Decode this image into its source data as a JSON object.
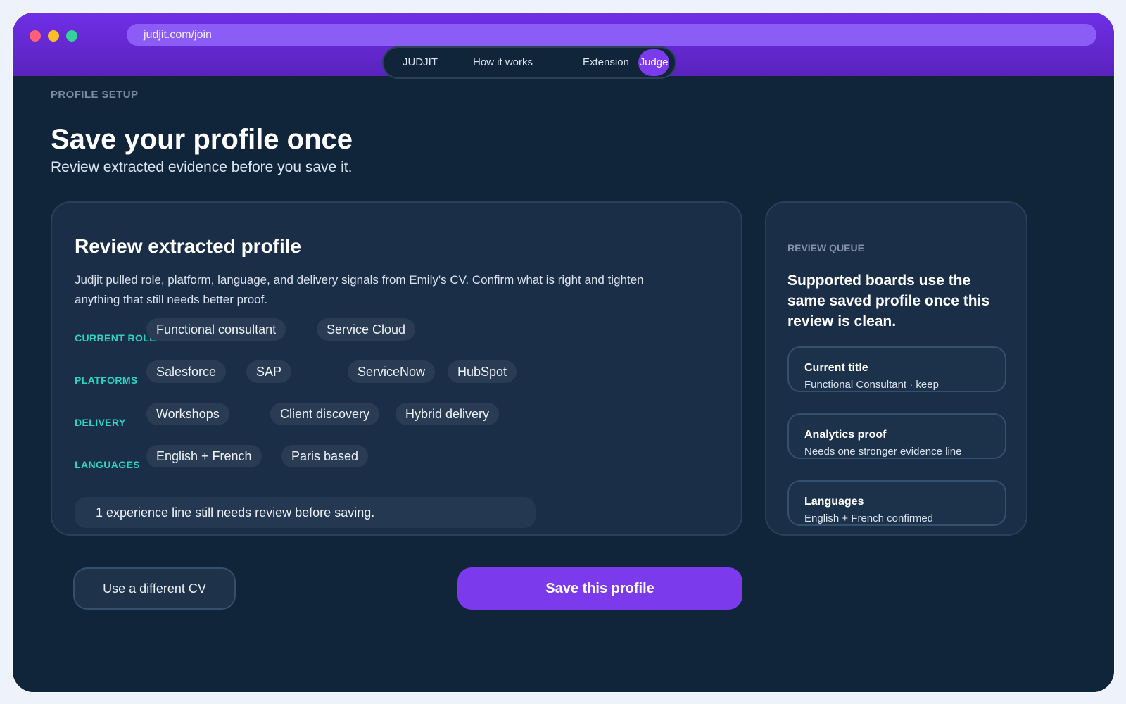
{
  "browser": {
    "url": "judjit.com/join"
  },
  "nav": {
    "brand": "JUDJIT",
    "how_it_works": "How it works",
    "extension": "Extension",
    "judge": "Judge"
  },
  "header": {
    "eyebrow": "PROFILE SETUP",
    "title": "Save your profile once",
    "subtitle": "Review extracted evidence before you save it."
  },
  "review_card": {
    "title": "Review extracted profile",
    "description": "Judjit pulled role, platform, language, and delivery signals from Emily's CV. Confirm what is right and tighten anything that still needs better proof.",
    "rows": [
      {
        "label": "CURRENT ROLE",
        "chips": [
          "Functional consultant",
          "Service Cloud"
        ]
      },
      {
        "label": "PLATFORMS",
        "chips": [
          "Salesforce",
          "SAP",
          "ServiceNow",
          "HubSpot"
        ]
      },
      {
        "label": "DELIVERY",
        "chips": [
          "Workshops",
          "Client discovery",
          "Hybrid delivery"
        ]
      },
      {
        "label": "LANGUAGES",
        "chips": [
          "English + French",
          "Paris based"
        ]
      }
    ],
    "notice": "1 experience line still needs review before saving."
  },
  "review_queue": {
    "eyebrow": "REVIEW QUEUE",
    "text": "Supported boards use the same saved profile once this review is clean.",
    "items": [
      {
        "title": "Current title",
        "status": "Functional Consultant · keep"
      },
      {
        "title": "Analytics proof",
        "status": "Needs one stronger evidence line"
      },
      {
        "title": "Languages",
        "status": "English + French confirmed"
      }
    ]
  },
  "actions": {
    "secondary": "Use a different CV",
    "primary": "Save this profile"
  },
  "colors": {
    "accent": "#7c3aed",
    "background": "#10243a",
    "card": "#1b2e47",
    "label": "#2dd4bf"
  }
}
